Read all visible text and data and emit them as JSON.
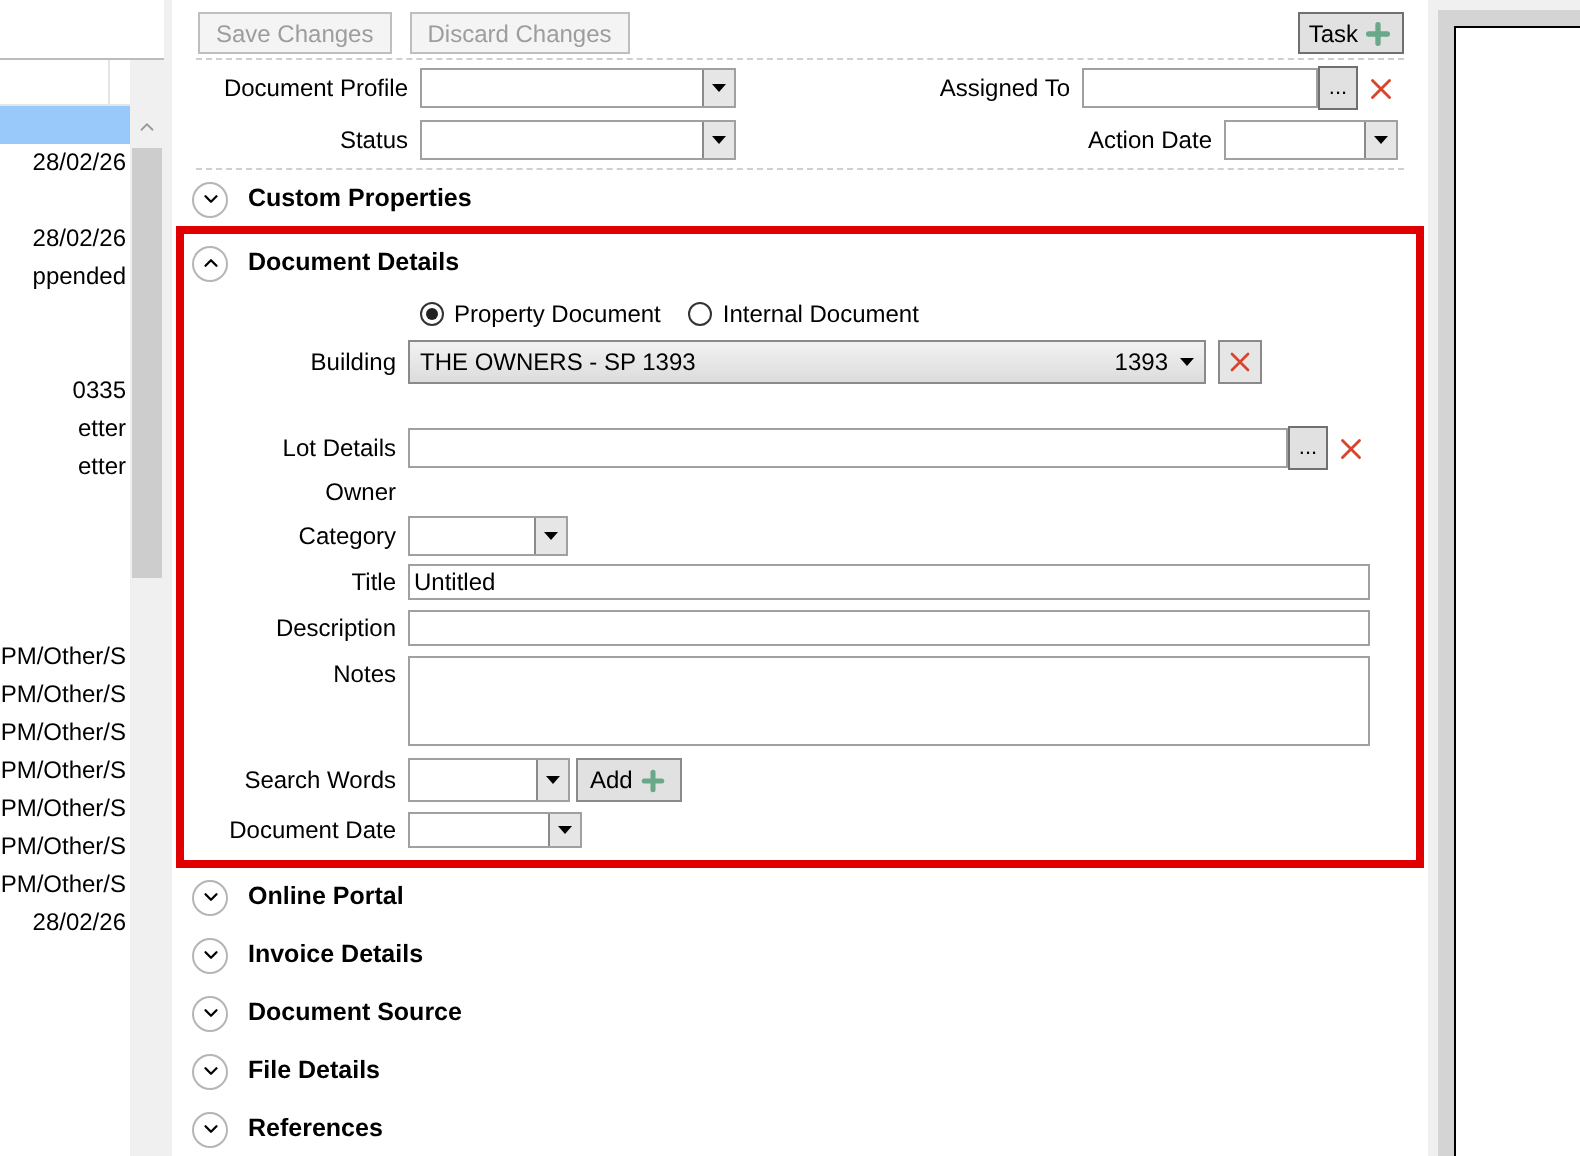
{
  "document_list": {
    "rows": [
      {
        "text": "",
        "selected": true
      },
      {
        "text": "28/02/26",
        "selected": false
      },
      {
        "text": "",
        "selected": false
      },
      {
        "text": "28/02/26",
        "selected": false
      },
      {
        "text": "ppended",
        "selected": false
      },
      {
        "text": "",
        "selected": false
      },
      {
        "text": "",
        "selected": false
      },
      {
        "text": "0335",
        "selected": false
      },
      {
        "text": "etter",
        "selected": false
      },
      {
        "text": "etter",
        "selected": false
      },
      {
        "text": "",
        "selected": false
      },
      {
        "text": "",
        "selected": false
      },
      {
        "text": "",
        "selected": false
      },
      {
        "text": "",
        "selected": false
      },
      {
        "text": "PM/Other/S",
        "selected": false
      },
      {
        "text": "PM/Other/S",
        "selected": false
      },
      {
        "text": "PM/Other/S",
        "selected": false
      },
      {
        "text": "PM/Other/S",
        "selected": false
      },
      {
        "text": "PM/Other/S",
        "selected": false
      },
      {
        "text": "PM/Other/S",
        "selected": false
      },
      {
        "text": "PM/Other/S",
        "selected": false
      },
      {
        "text": "28/02/26",
        "selected": false
      }
    ]
  },
  "toolbar": {
    "buttons": [
      {
        "label": "Save Changes",
        "disabled": true
      },
      {
        "label": "Discard Changes",
        "disabled": true
      }
    ],
    "task_button": {
      "label": "Task"
    }
  },
  "header_fields": [
    {
      "label": "Document Profile",
      "kind": "select"
    },
    {
      "label": "Assigned To",
      "kind": "picker",
      "browse_label": "..."
    },
    {
      "label": "Status",
      "kind": "select"
    },
    {
      "label": "Action Date",
      "kind": "date"
    }
  ],
  "sections": [
    {
      "title": "Custom Properties",
      "expanded": false,
      "highlighted": false
    },
    {
      "title": "Document Details",
      "expanded": true,
      "highlighted": true
    },
    {
      "title": "Online Portal",
      "expanded": false,
      "highlighted": false
    },
    {
      "title": "Invoice Details",
      "expanded": false,
      "highlighted": false
    },
    {
      "title": "Document Source",
      "expanded": false,
      "highlighted": false
    },
    {
      "title": "File Details",
      "expanded": false,
      "highlighted": false
    },
    {
      "title": "References",
      "expanded": false,
      "highlighted": false
    }
  ],
  "document_details": {
    "document_type": [
      {
        "label": "Property Document",
        "selected": true
      },
      {
        "label": "Internal Document",
        "selected": false
      }
    ],
    "fields": [
      {
        "kind": "building",
        "label": "Building",
        "value": "THE OWNERS - SP 1393",
        "code": "1393"
      },
      {
        "kind": "picker",
        "label": "Lot Details",
        "browse_label": "..."
      },
      {
        "kind": "label",
        "label": "Owner"
      },
      {
        "kind": "select",
        "label": "Category"
      },
      {
        "kind": "text",
        "label": "Title",
        "value": "Untitled"
      },
      {
        "kind": "text",
        "label": "Description"
      },
      {
        "kind": "textarea",
        "label": "Notes"
      },
      {
        "kind": "keywords",
        "label": "Search Words",
        "button": "Add"
      },
      {
        "kind": "date",
        "label": "Document Date"
      }
    ]
  }
}
